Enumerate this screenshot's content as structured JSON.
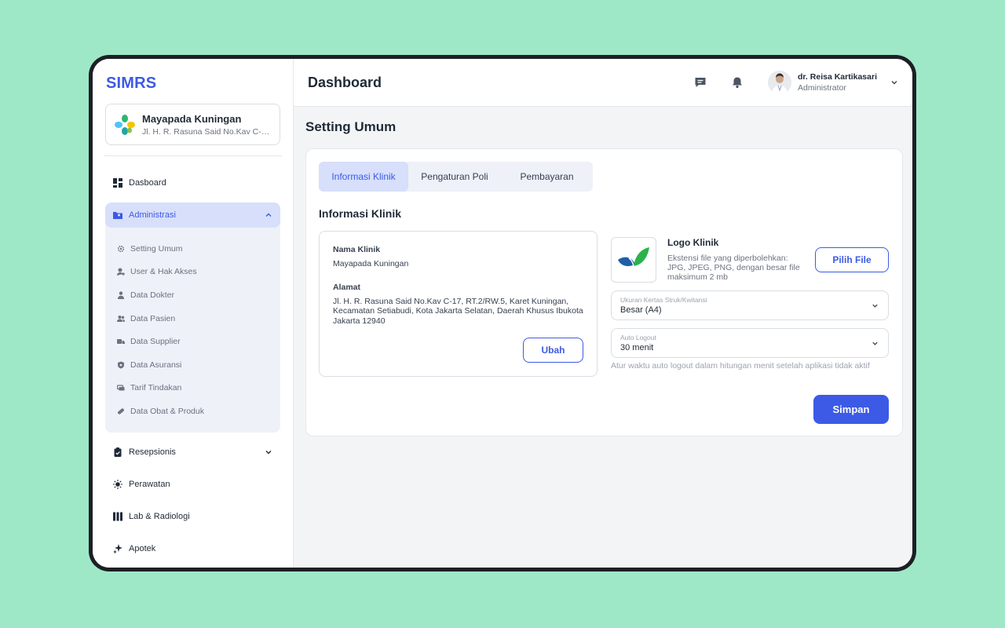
{
  "app": {
    "brand": "SIMRS",
    "accent": "#3c5ae6"
  },
  "clinic": {
    "name": "Mayapada Kuningan",
    "address": "Jl. H. R. Rasuna Said No.Kav C-17, RT.2/RW.5"
  },
  "sidebar": {
    "items": [
      {
        "label": "Dasboard",
        "icon": "grid-icon"
      },
      {
        "label": "Administrasi",
        "icon": "folder-icon",
        "expanded": true,
        "active": true
      },
      {
        "label": "Resepsionis",
        "icon": "clipboard-icon"
      },
      {
        "label": "Perawatan",
        "icon": "sun-icon"
      },
      {
        "label": "Lab & Radiologi",
        "icon": "columns-icon"
      },
      {
        "label": "Apotek",
        "icon": "sparkle-icon"
      }
    ],
    "admin_sub": [
      {
        "label": "Setting Umum",
        "icon": "gear-icon"
      },
      {
        "label": "User & Hak Akses",
        "icon": "user-key-icon"
      },
      {
        "label": "Data Dokter",
        "icon": "doctor-icon"
      },
      {
        "label": "Data Pasien",
        "icon": "users-icon"
      },
      {
        "label": "Data Supplier",
        "icon": "truck-icon"
      },
      {
        "label": "Data Asuransi",
        "icon": "shield-icon"
      },
      {
        "label": "Tarif Tindakan",
        "icon": "money-icon"
      },
      {
        "label": "Data Obat & Produk",
        "icon": "pill-icon"
      }
    ]
  },
  "header": {
    "title": "Dashboard",
    "user": {
      "name": "dr. Reisa Kartikasari",
      "role": "Administrator"
    }
  },
  "page": {
    "title": "Setting Umum",
    "tabs": [
      "Informasi Klinik",
      "Pengaturan Poli",
      "Pembayaran"
    ],
    "section_title": "Informasi Klinik",
    "info": {
      "name_label": "Nama Klinik",
      "name_value": "Mayapada Kuningan",
      "address_label": "Alamat",
      "address_value": "Jl. H. R. Rasuna Said No.Kav C-17, RT.2/RW.5, Karet Kuningan, Kecamatan Setiabudi, Kota Jakarta Selatan, Daerah Khusus Ibukota Jakarta 12940",
      "edit_label": "Ubah"
    },
    "logo": {
      "title": "Logo Klinik",
      "desc": "Ekstensi file yang diperbolehkan: JPG, JPEG, PNG, dengan besar file maksimum 2 mb",
      "button": "Pilih File"
    },
    "paper_size": {
      "label": "Ukuran Kertas Struk/Kwitansi",
      "value": "Besar (A4)"
    },
    "auto_logout": {
      "label": "Auto Logout",
      "value": "30 menit",
      "hint": "Atur waktu auto logout dalam hitungan menit setelah aplikasi tidak aktif"
    },
    "save_label": "Simpan"
  }
}
